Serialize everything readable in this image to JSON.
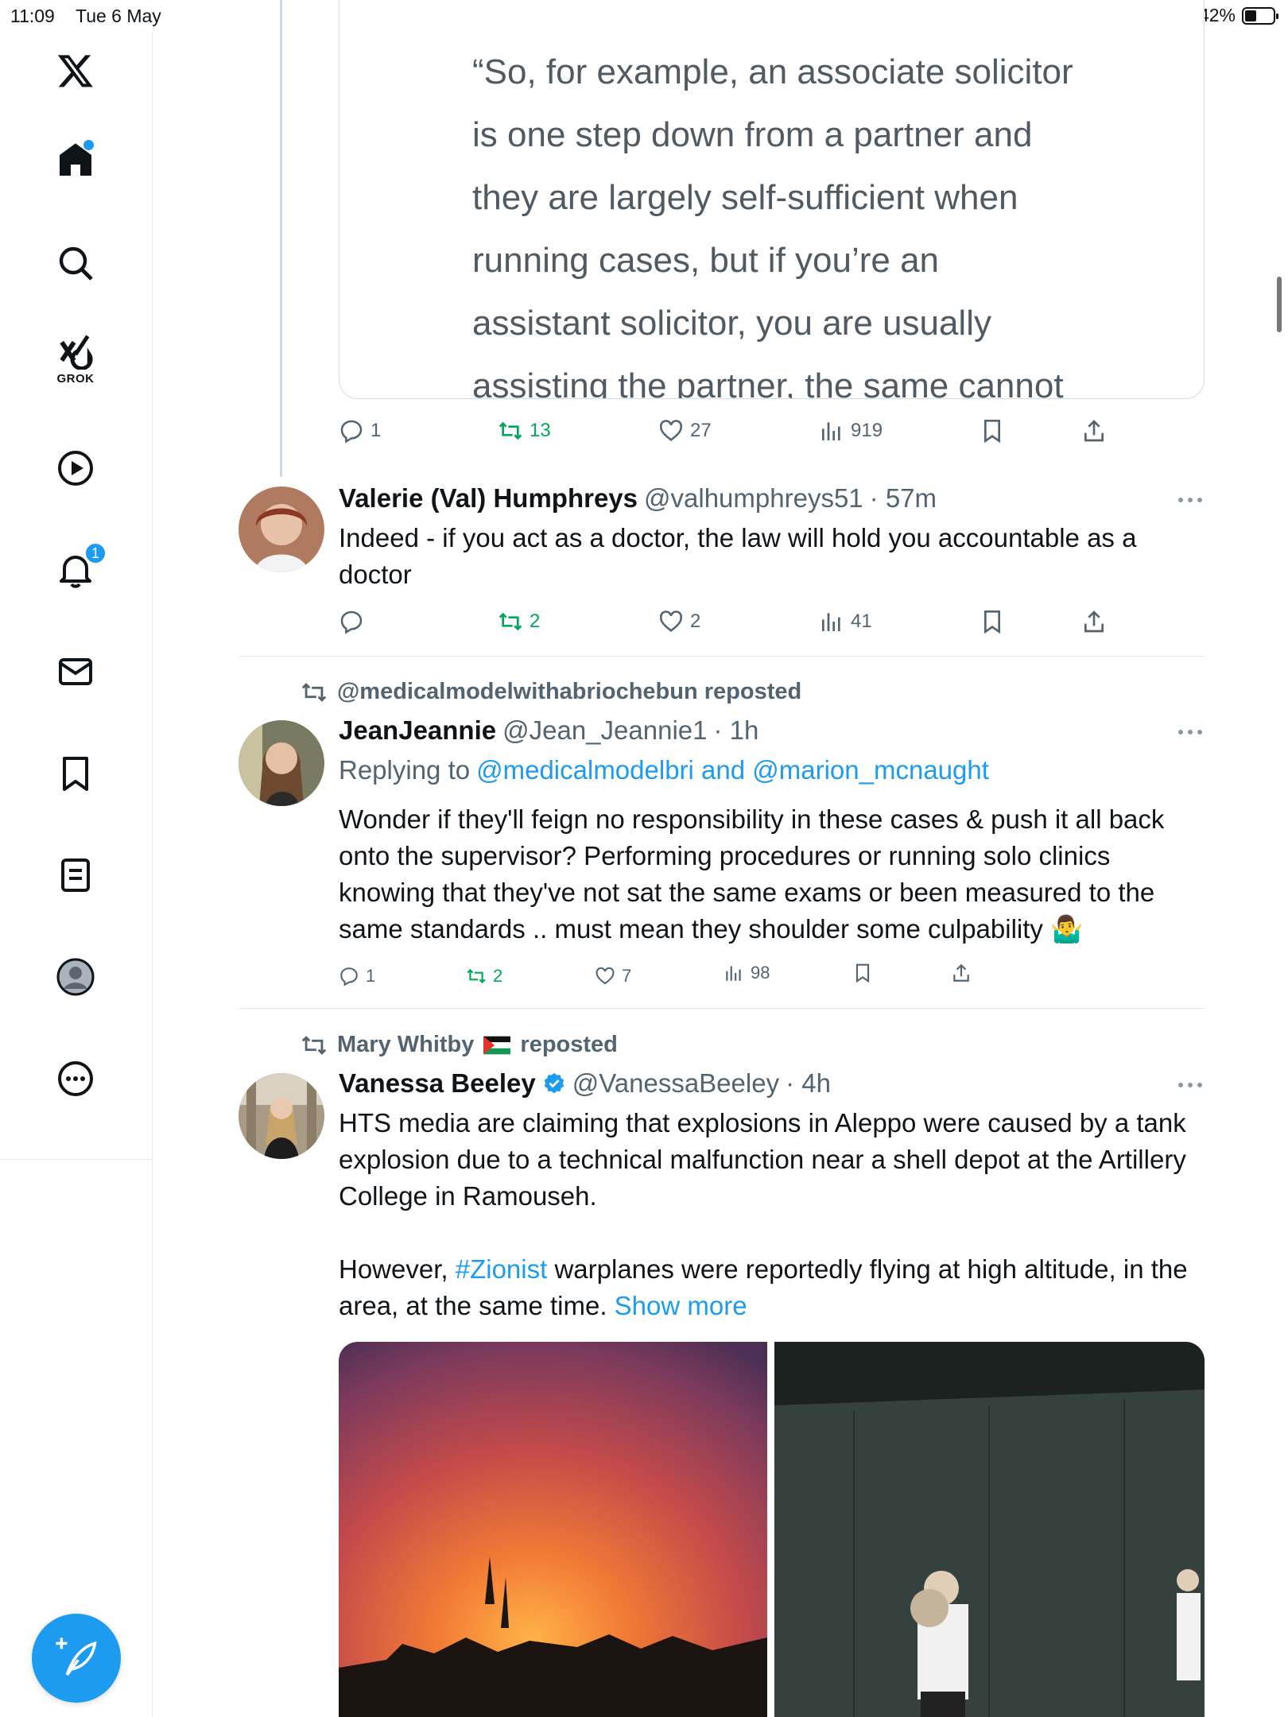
{
  "status_bar": {
    "time": "11:09",
    "date": "Tue 6 May",
    "battery": "42%",
    "battery_level": 0.42
  },
  "sidebar": {
    "items": [
      {
        "name": "x-logo"
      },
      {
        "name": "home",
        "has_dot": true
      },
      {
        "name": "search"
      },
      {
        "name": "grok",
        "label": "GROK"
      },
      {
        "name": "videos"
      },
      {
        "name": "notifications",
        "badge": "1"
      },
      {
        "name": "messages"
      },
      {
        "name": "bookmarks"
      },
      {
        "name": "lists"
      },
      {
        "name": "profile"
      },
      {
        "name": "more"
      }
    ],
    "compose_label": "Post"
  },
  "quoted_tweet": {
    "text": "“So, for example, an associate solicitor\nis one step down from a partner and\nthey are largely self-sufficient when\nrunning cases, but if you’re an\nassistant solicitor, you are usually\nassisting the partner, the same cannot",
    "actions": {
      "replies": "1",
      "reposts": "13",
      "likes": "27",
      "views": "919"
    }
  },
  "tweets": [
    {
      "name": "Valerie (Val) Humphreys",
      "handle": "@valhumphreys51",
      "time": "· 57m",
      "text": "Indeed - if you act as a doctor, the law will hold you accountable as a doctor",
      "actions": {
        "replies": "",
        "reposts": "2",
        "likes": "2",
        "views": "41"
      }
    },
    {
      "reposted_by": "@medicalmodelwithabriochebun reposted",
      "name": "JeanJeannie",
      "handle": "@Jean_Jeannie1",
      "time": "· 1h",
      "replying_prefix": "Replying to",
      "replying_to": "@medicalmodelbri and @marion_mcnaught",
      "text": "Wonder if they'll feign no responsibility in these cases & push it all back onto the supervisor? Performing procedures or running solo clinics knowing that they've not sat the same exams or been measured to the same standards .. must mean they shoulder some culpability 🤷‍♂️",
      "actions": {
        "replies": "1",
        "reposts": "2",
        "likes": "7",
        "views": "98"
      }
    },
    {
      "reposted_by_name": "Mary Whitby",
      "reposted_suffix": "reposted",
      "name": "Vanessa Beeley",
      "verified": true,
      "handle": "@VanessaBeeley",
      "time": "· 4h",
      "text_p1": "HTS media are claiming that explosions in Aleppo were caused by a tank explosion due to a technical malfunction near a shell depot at the Artillery College in Ramouseh.",
      "text_p2_a": "However, ",
      "hashtag": "#Zionist",
      "text_p2_b": " warplanes were reportedly flying at high altitude, in the area,  at the same time. ",
      "show_more": "Show more"
    }
  ],
  "colors": {
    "accent": "#1d9bf0",
    "repost_green": "#00a85a",
    "secondary_text": "#536471"
  }
}
